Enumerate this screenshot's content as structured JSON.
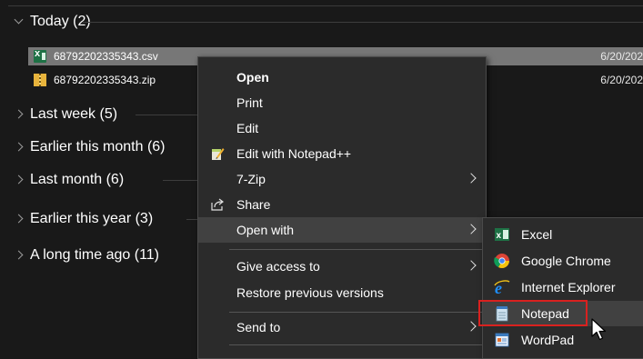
{
  "explorer": {
    "groups": [
      {
        "label": "Today (2)",
        "expanded": true
      },
      {
        "label": "Last week (5)",
        "expanded": false
      },
      {
        "label": "Earlier this month (6)",
        "expanded": false
      },
      {
        "label": "Last month (6)",
        "expanded": false
      },
      {
        "label": "Earlier this year (3)",
        "expanded": false
      },
      {
        "label": "A long time ago (11)",
        "expanded": false
      }
    ],
    "files": [
      {
        "name": "68792202335343.csv",
        "date": "6/20/202",
        "icon": "excel-csv-icon",
        "selected": true
      },
      {
        "name": "68792202335343.zip",
        "date": "6/20/202",
        "icon": "zip-folder-icon",
        "selected": false
      }
    ]
  },
  "context_menu": {
    "items": {
      "open": "Open",
      "print": "Print",
      "edit": "Edit",
      "edit_notepadpp": "Edit with Notepad++",
      "seven_zip": "7-Zip",
      "share": "Share",
      "open_with": "Open with",
      "give_access": "Give access to",
      "restore": "Restore previous versions",
      "send_to": "Send to"
    },
    "highlighted": "Open with"
  },
  "open_with_menu": {
    "items": [
      {
        "label": "Excel",
        "icon": "excel-icon"
      },
      {
        "label": "Google Chrome",
        "icon": "chrome-icon"
      },
      {
        "label": "Internet Explorer",
        "icon": "internet-explorer-icon"
      },
      {
        "label": "Notepad",
        "icon": "notepad-icon"
      },
      {
        "label": "WordPad",
        "icon": "wordpad-icon"
      }
    ],
    "highlighted": "Notepad",
    "highlight_color": "#d9211f"
  },
  "colors": {
    "background": "#191919",
    "selected_row": "#777777",
    "menu_bg": "#2b2b2b",
    "menu_hover": "#414141"
  }
}
